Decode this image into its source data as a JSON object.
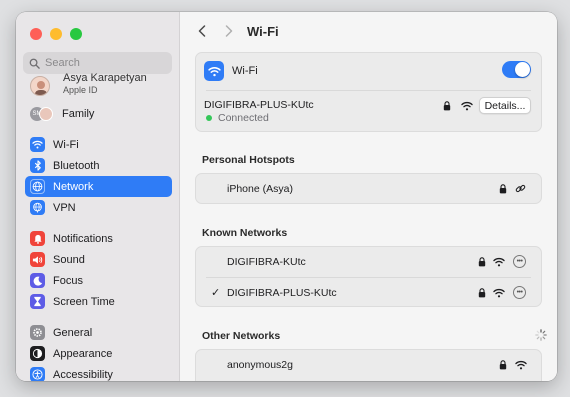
{
  "window": {
    "title": "Wi-Fi"
  },
  "sidebar": {
    "search_placeholder": "Search",
    "account": {
      "name": "Asya Karapetyan",
      "subtitle": "Apple ID"
    },
    "family": {
      "label": "Family",
      "initials": "SM"
    },
    "items": [
      {
        "label": "Wi-Fi",
        "icon": "wifi-icon",
        "color": "#2f7cf6"
      },
      {
        "label": "Bluetooth",
        "icon": "bluetooth-icon",
        "color": "#2f7cf6"
      },
      {
        "label": "Network",
        "icon": "globe-icon",
        "color": "#2f7cf6",
        "selected": true
      },
      {
        "label": "VPN",
        "icon": "globe-lock-icon",
        "color": "#2f7cf6"
      },
      {
        "label": "Notifications",
        "icon": "bell-icon",
        "color": "#f0443a"
      },
      {
        "label": "Sound",
        "icon": "speaker-icon",
        "color": "#f0443a"
      },
      {
        "label": "Focus",
        "icon": "moon-icon",
        "color": "#5e5ce6"
      },
      {
        "label": "Screen Time",
        "icon": "hourglass-icon",
        "color": "#5e5ce6"
      },
      {
        "label": "General",
        "icon": "gear-icon",
        "color": "#8e8e93"
      },
      {
        "label": "Appearance",
        "icon": "appearance-icon",
        "color": "#1d1d1f"
      },
      {
        "label": "Accessibility",
        "icon": "accessibility-icon",
        "color": "#2f7cf6"
      }
    ]
  },
  "main": {
    "wifi_label": "Wi-Fi",
    "wifi_enabled": true,
    "current_network": {
      "name": "DIGIFIBRA-PLUS-KUtc",
      "status": "Connected",
      "details_label": "Details..."
    },
    "personal_hotspots": {
      "title": "Personal Hotspots",
      "items": [
        {
          "name": "iPhone (Asya)"
        }
      ]
    },
    "known_networks": {
      "title": "Known Networks",
      "items": [
        {
          "name": "DIGIFIBRA-KUtc",
          "checked": false
        },
        {
          "name": "DIGIFIBRA-PLUS-KUtc",
          "checked": true
        }
      ]
    },
    "other_networks": {
      "title": "Other Networks",
      "items": [
        {
          "name": "anonymous2g"
        }
      ]
    }
  }
}
